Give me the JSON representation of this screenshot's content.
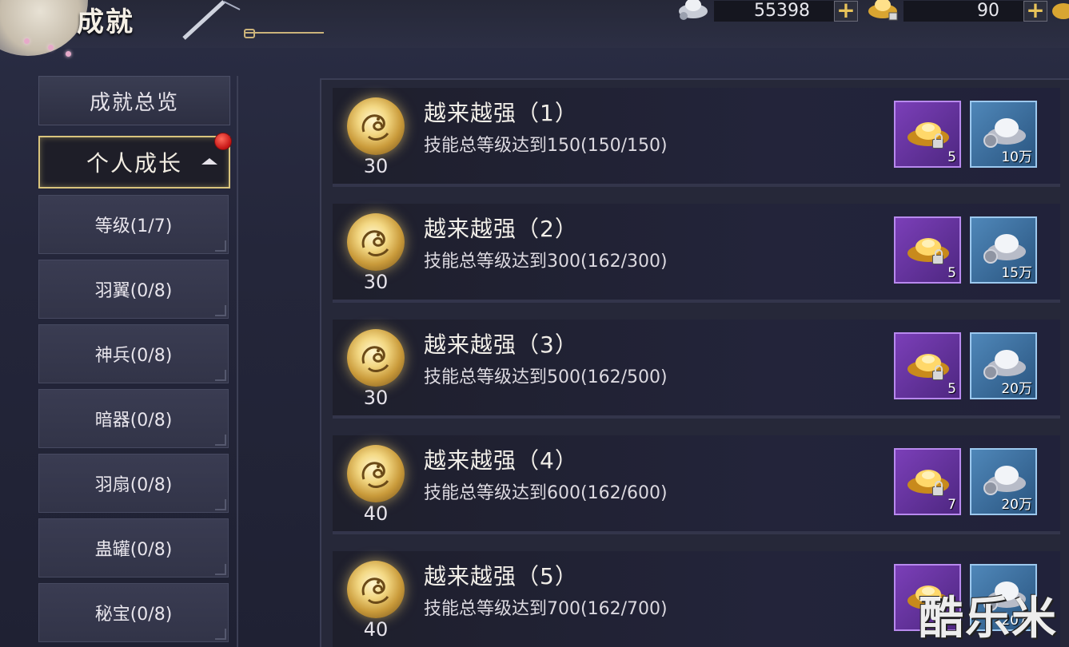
{
  "header": {
    "title": "成就",
    "currencies": [
      {
        "icon": "silver-ingot-icon",
        "value": "55398",
        "add_label": "+"
      },
      {
        "icon": "gold-ingot-locked-icon",
        "value": "90",
        "add_label": "+"
      }
    ]
  },
  "sidebar": {
    "overview_label": "成就总览",
    "group_label": "个人成长",
    "group_has_notification": true,
    "items": [
      {
        "label": "等级(1/7)"
      },
      {
        "label": "羽翼(0/8)"
      },
      {
        "label": "神兵(0/8)"
      },
      {
        "label": "暗器(0/8)"
      },
      {
        "label": "羽扇(0/8)"
      },
      {
        "label": "蛊罐(0/8)"
      },
      {
        "label": "秘宝(0/8)"
      }
    ]
  },
  "achievements": [
    {
      "title": "越来越强（1）",
      "desc": "技能总等级达到150(150/150)",
      "points": "30",
      "reward_gold": "5",
      "reward_silver": "10万"
    },
    {
      "title": "越来越强（2）",
      "desc": "技能总等级达到300(162/300)",
      "points": "30",
      "reward_gold": "5",
      "reward_silver": "15万"
    },
    {
      "title": "越来越强（3）",
      "desc": "技能总等级达到500(162/500)",
      "points": "30",
      "reward_gold": "5",
      "reward_silver": "20万"
    },
    {
      "title": "越来越强（4）",
      "desc": "技能总等级达到600(162/600)",
      "points": "40",
      "reward_gold": "7",
      "reward_silver": "20万"
    },
    {
      "title": "越来越强（5）",
      "desc": "技能总等级达到700(162/700)",
      "points": "40",
      "reward_gold": "",
      "reward_silver": "20万"
    }
  ],
  "watermark": "酷乐米",
  "colors": {
    "accent_gold": "#d9c47d",
    "notification_red": "#c41414",
    "gold_reward_bg": "#7b3fb8",
    "silver_reward_bg": "#4f87b9"
  }
}
